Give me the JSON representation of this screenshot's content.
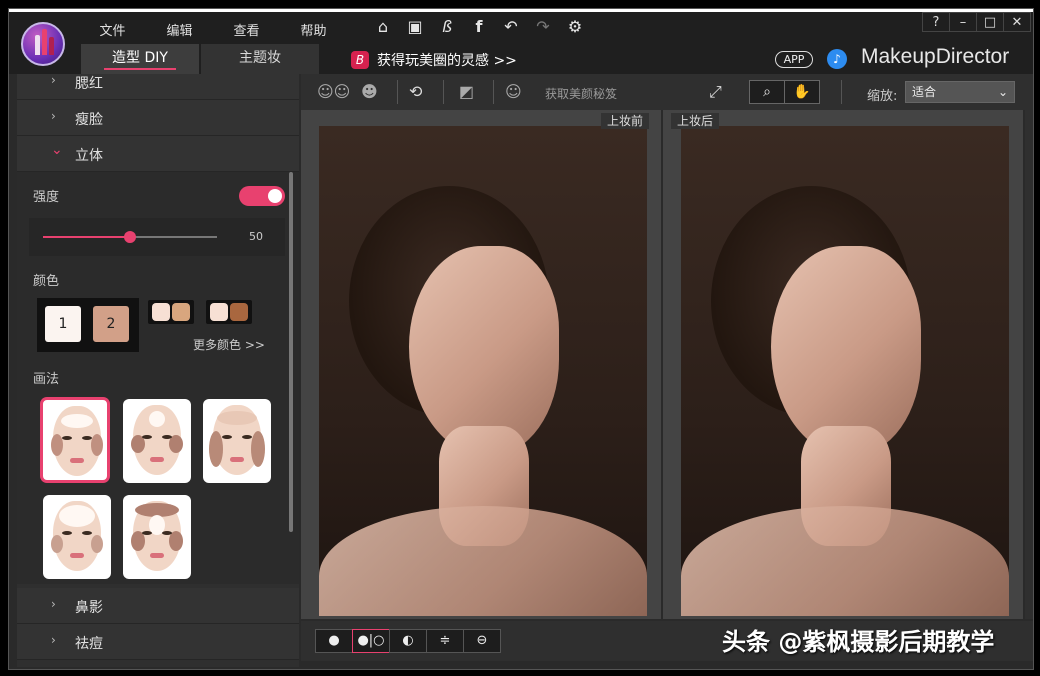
{
  "menu": [
    "文件",
    "编辑",
    "查看",
    "帮助"
  ],
  "toolbar_icons": [
    "home-icon",
    "save-icon",
    "brand-b-icon",
    "facebook-icon",
    "undo-icon",
    "redo-icon",
    "settings-icon"
  ],
  "window_controls": [
    "?",
    "–",
    "□",
    "✕"
  ],
  "tabs": [
    {
      "label": "造型 DIY",
      "active": true
    },
    {
      "label": "主题妆",
      "active": false
    }
  ],
  "promo": {
    "badge": "B",
    "text": "获得玩美圈的灵感 >>"
  },
  "app_badge": "APP",
  "brand": "MakeupDirector",
  "panel": {
    "rows_top": [
      "腮红",
      "瘦脸"
    ],
    "open_row": "立体",
    "strength_label": "强度",
    "strength_value": "50",
    "strength_fraction": 0.5,
    "color_label": "颜色",
    "swatch1": "1",
    "swatch2": "2",
    "more_colors": "更多颜色 >>",
    "method_label": "画法",
    "rows_bottom": [
      "鼻影",
      "祛痘"
    ]
  },
  "center_toolbar": {
    "hint": "获取美颜秘笈",
    "zoom_label": "缩放:",
    "zoom_value": "适合"
  },
  "panes": {
    "before": "上妆前",
    "after": "上妆后"
  },
  "watermark": "头条 @紫枫摄影后期教学",
  "colors": {
    "accent": "#e8416f",
    "swatch1": "#fbf4f0",
    "swatch2": "#d2a088"
  }
}
